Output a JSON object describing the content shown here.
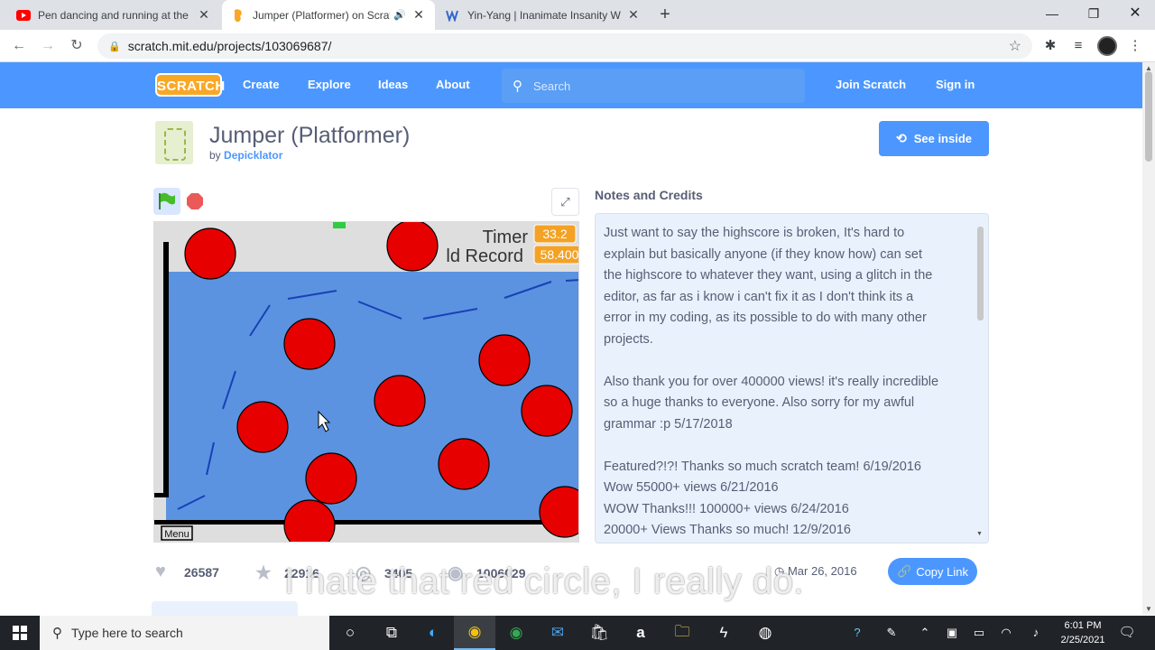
{
  "browser": {
    "tabs": [
      {
        "title": "Pen dancing and running at the sam",
        "favicon": "youtube-icon",
        "active": false
      },
      {
        "title": "Jumper (Platformer) on Scratch",
        "favicon": "scratch-icon",
        "active": true,
        "audio": true
      },
      {
        "title": "Yin-Yang | Inanimate Insanity Wiki |",
        "favicon": "wiki-icon",
        "active": false
      }
    ],
    "new_tab_label": "+",
    "url": "scratch.mit.edu/projects/103069687/"
  },
  "site_nav": {
    "logo_text": "SCRATCH",
    "links": [
      "Create",
      "Explore",
      "Ideas",
      "About"
    ],
    "search_placeholder": "Search",
    "join_label": "Join Scratch",
    "signin_label": "Sign in"
  },
  "project": {
    "title": "Jumper (Platformer)",
    "by_prefix": "by",
    "author": "Depicklator",
    "see_inside_label": "See inside"
  },
  "stage": {
    "timer_label": "Timer",
    "timer_value": "33.2",
    "record_label": "ld Record",
    "record_value": "58.400",
    "menu_label": "Menu"
  },
  "notes": {
    "heading": "Notes and Credits",
    "paragraphs": [
      [
        "Just want to say the highscore is broken, It's hard to",
        "explain but basically anyone (if they know how) can set",
        "the highscore to whatever they want, using a glitch in the",
        "editor, as far as i know i can't fix it as I don't think its a",
        "error in my coding, as its possible to do with many other",
        "projects."
      ],
      [
        "Also thank you for over 400000 views! it's really incredible",
        "so a huge thanks to everyone. Also sorry for my awful",
        "grammar :p 5/17/2018"
      ],
      [
        "Featured?!?! Thanks so much scratch team! 6/19/2016",
        "Wow 55000+ views 6/21/2016",
        "WOW Thanks!!! 100000+ views 6/24/2016",
        "20000+ Views Thanks so much! 12/9/2016"
      ]
    ]
  },
  "stats": {
    "loves": "26587",
    "favorites": "22916",
    "remixes": "3405",
    "views": "1006029",
    "date": "Mar 26, 2016",
    "copy_link_label": "Copy Link"
  },
  "caption": "I hate that red circle, I really do.",
  "taskbar": {
    "search_placeholder": "Type here to search",
    "time": "6:01 PM",
    "date": "2/25/2021"
  },
  "colors": {
    "scratch_blue": "#4c97ff",
    "stage_water": "#5b93e0",
    "hazard_red": "#e60000",
    "timer_orange": "#f4a225"
  }
}
